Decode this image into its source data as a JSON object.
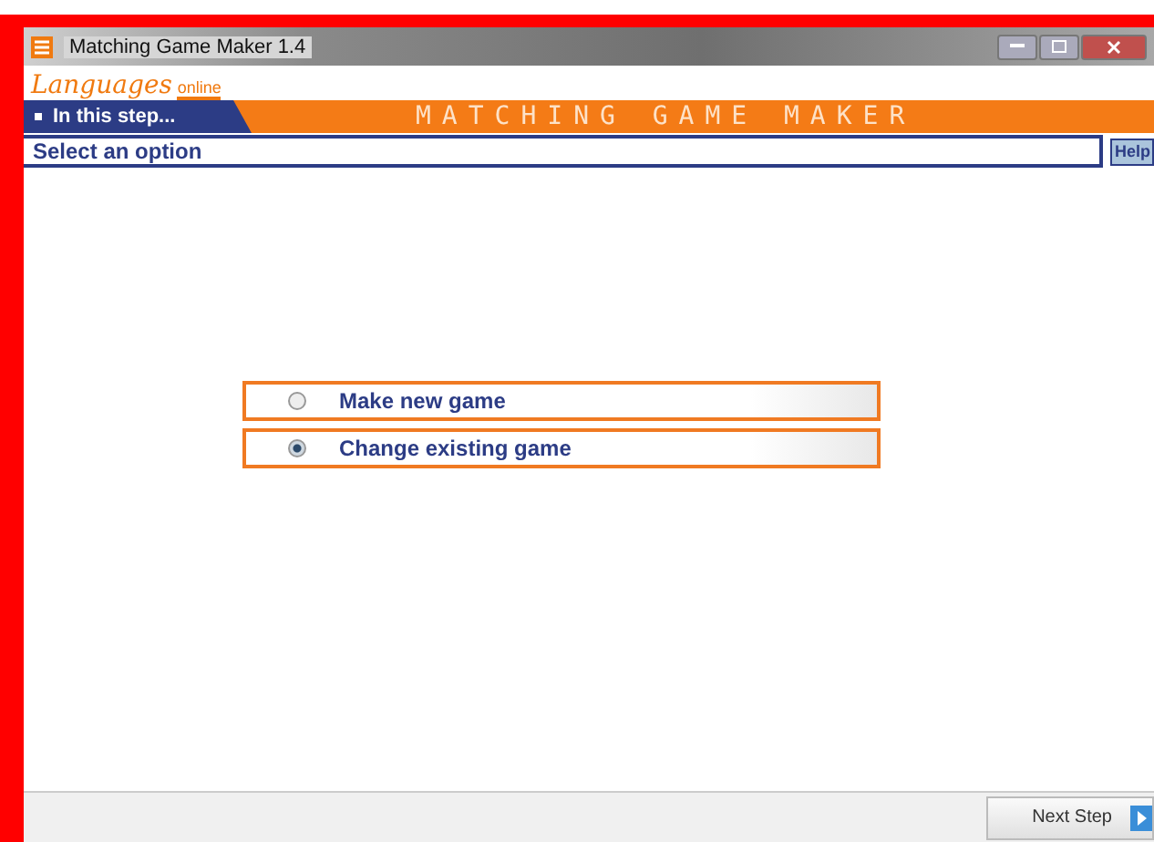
{
  "window": {
    "title": "Matching Game Maker 1.4"
  },
  "logo": {
    "word": "Languages",
    "sub": "online"
  },
  "step_tab": {
    "label": "In this step..."
  },
  "banner": {
    "title": "MATCHING GAME MAKER"
  },
  "instruction": {
    "text": "Select an option"
  },
  "help_button": {
    "label": "Help"
  },
  "options": [
    {
      "label": "Make new game",
      "selected": false
    },
    {
      "label": "Change existing game",
      "selected": true
    }
  ],
  "next_button": {
    "label": "Next Step"
  }
}
